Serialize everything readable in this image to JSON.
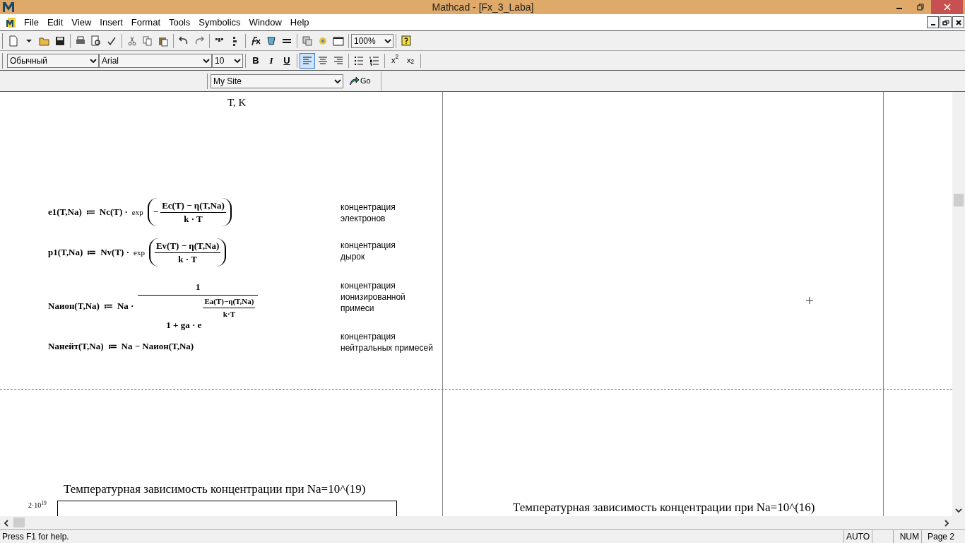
{
  "window": {
    "title": "Mathcad - [Fx_3_Laba]"
  },
  "menu": [
    "File",
    "Edit",
    "View",
    "Insert",
    "Format",
    "Tools",
    "Symbolics",
    "Window",
    "Help"
  ],
  "standard_toolbar": {
    "zoom": "100%"
  },
  "formatting_toolbar": {
    "style": "Обычный",
    "font": "Arial",
    "size": "10",
    "format_buttons": [
      "B",
      "I",
      "U"
    ],
    "alignment": [
      {
        "selected": true
      },
      {
        "selected": false
      },
      {
        "selected": false
      }
    ],
    "script_buttons": [
      "x$^{2}$",
      "x$_{2}$"
    ]
  },
  "web_toolbar": {
    "address": "My Site",
    "go": "Go"
  },
  "worksheet": {
    "axis_label": "T, K",
    "formulas": [
      {
        "kind": "exp",
        "lhs": "e1(T,Na)",
        "assign": "≔",
        "factor": "Nc(T) ·",
        "function": "exp",
        "sign": "−",
        "numerator": "Ec(T) − η(T,Na)",
        "denominator": "k · T",
        "note": "концентрация\nэлектронов"
      },
      {
        "kind": "exp",
        "lhs": "p1(T,Na)",
        "assign": "≔",
        "factor": "Nv(T) ·",
        "function": "exp",
        "numerator": "Ev(T) − η(T,Na)",
        "denominator": "k · T",
        "note": "концентрация\nдырок"
      },
      {
        "kind": "reciprocal",
        "lhs": "Naион(T,Na)",
        "assign": "≔",
        "factor": "Na ·",
        "numerator": "1",
        "base": "1 + ga · e",
        "exp_numerator": "Ea(T)−η(T,Na)",
        "exp_denominator": "k·T",
        "note": "концентрация\nионизированной\nпримеси"
      },
      {
        "kind": "plain",
        "lhs": "Naнейт(T,Na)",
        "assign": "≔",
        "rhs": "Na − Naион(T,Na)",
        "note": "концентрация\nнейтральных примесей"
      }
    ],
    "charts": [
      {
        "title": "Температурная зависимость концентрации при Na=10^(19)",
        "tick": "2·10$^{19}$"
      },
      {
        "title": "Температурная зависимость концентрации при Na=10^(16)"
      }
    ]
  },
  "status_bar": {
    "help": "Press F1 for help.",
    "panels": [
      "AUTO",
      "NUM",
      "Page 2"
    ]
  }
}
